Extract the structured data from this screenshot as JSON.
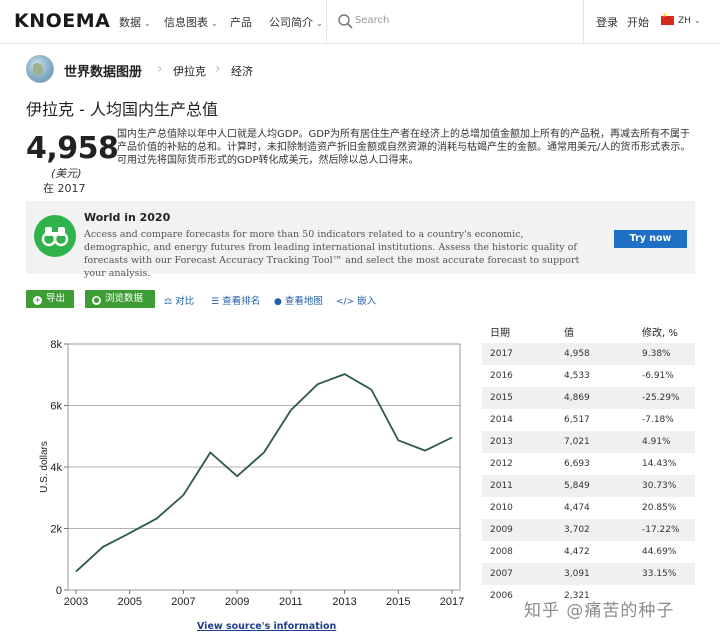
{
  "nav": {
    "logo": "KNOEMA",
    "items": [
      {
        "label": "数据",
        "has_dropdown": true
      },
      {
        "label": "信息图表",
        "has_dropdown": true
      },
      {
        "label": "产品",
        "has_dropdown": false
      },
      {
        "label": "公司简介",
        "has_dropdown": true
      }
    ],
    "search_placeholder": "Search",
    "login": "登录",
    "start": "开始",
    "lang": "ZH"
  },
  "breadcrumb": {
    "root": "世界数据图册",
    "country": "伊拉克",
    "category": "经济"
  },
  "page_title": "伊拉克 - 人均国内生产总值",
  "headline": {
    "value": "4,958",
    "unit": "(美元)",
    "year": "在 2017"
  },
  "description": "国内生产总值除以年中人口就是人均GDP。GDP为所有居住生产者在经济上的总增加值金额加上所有的产品税，再减去所有不属于产品价值的补贴的总和。计算时，未扣除制造资产折旧金额或自然资源的消耗与枯竭产生的金额。通常用美元/人的货币形式表示。可用过先将国际货币形式的GDP转化成美元，然后除以总人口得来。",
  "banner": {
    "title": "World in 2020",
    "text": "Access and compare forecasts for more than 50 indicators related to a country's economic, demographic, and energy futures from leading international institutions. Assess the historic quality of forecasts with our Forecast Accuracy Tracking Tool™ and select the most accurate forecast to support your analysis.",
    "button": "Try now",
    "accent": "#2fb34a",
    "button_color": "#1f6fc5"
  },
  "toolbar": {
    "export": "导出",
    "browse": "浏览数据",
    "compare": "对比",
    "ranking": "查看排名",
    "map": "查看地图",
    "embed": "嵌入"
  },
  "chart_data": {
    "type": "line",
    "ylabel": "U.S. dollars",
    "xlabel": "",
    "x": [
      2003,
      2004,
      2005,
      2006,
      2007,
      2008,
      2009,
      2010,
      2011,
      2012,
      2013,
      2014,
      2015,
      2016,
      2017
    ],
    "values": [
      600,
      1400,
      1850,
      2321,
      3091,
      4472,
      3702,
      4474,
      5849,
      6693,
      7021,
      6517,
      4869,
      4533,
      4958
    ],
    "x_ticks": [
      "2003",
      "2005",
      "2007",
      "2009",
      "2011",
      "2013",
      "2015",
      "2017"
    ],
    "y_ticks": [
      "0",
      "2k",
      "4k",
      "6k",
      "8k"
    ],
    "ylim": [
      0,
      8000
    ],
    "grid": true,
    "line_color": "#2f5a45",
    "source_link": "View source's information"
  },
  "table": {
    "headers": [
      "日期",
      "值",
      "修改, %"
    ],
    "rows": [
      [
        "2017",
        "4,958",
        "9.38%"
      ],
      [
        "2016",
        "4,533",
        "-6.91%"
      ],
      [
        "2015",
        "4,869",
        "-25.29%"
      ],
      [
        "2014",
        "6,517",
        "-7.18%"
      ],
      [
        "2013",
        "7,021",
        "4.91%"
      ],
      [
        "2012",
        "6,693",
        "14.43%"
      ],
      [
        "2011",
        "5,849",
        "30.73%"
      ],
      [
        "2010",
        "4,474",
        "20.85%"
      ],
      [
        "2009",
        "3,702",
        "-17.22%"
      ],
      [
        "2008",
        "4,472",
        "44.69%"
      ],
      [
        "2007",
        "3,091",
        "33.15%"
      ],
      [
        "2006",
        "2,321",
        ""
      ]
    ]
  },
  "watermark": "知乎 @痛苦的种子"
}
